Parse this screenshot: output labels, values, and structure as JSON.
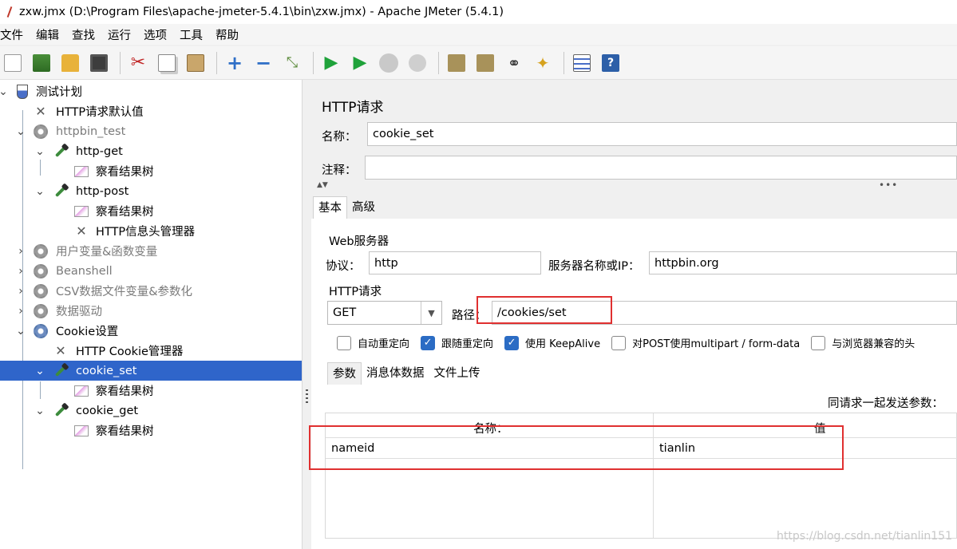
{
  "window": {
    "title": "zxw.jmx (D:\\Program Files\\apache-jmeter-5.4.1\\bin\\zxw.jmx) - Apache JMeter (5.4.1)"
  },
  "menu": [
    "文件",
    "编辑",
    "查找",
    "运行",
    "选项",
    "工具",
    "帮助"
  ],
  "toolbar": {
    "icons": [
      "new-icon",
      "templates-icon",
      "open-icon",
      "save-icon",
      "cut-icon",
      "copy-icon",
      "paste-icon",
      "expand-icon",
      "collapse-icon",
      "toggle-icon",
      "start-icon",
      "start-no-pauses-icon",
      "stop-icon",
      "shutdown-icon",
      "clear-icon",
      "clear-all-icon",
      "search-icon",
      "reset-search-icon",
      "function-helper-icon",
      "help-icon"
    ]
  },
  "tree": {
    "items": [
      {
        "label": "测试计划",
        "icon": "flask-icon",
        "level": 0
      },
      {
        "label": "HTTP请求默认值",
        "icon": "wrench-icon",
        "level": 1
      },
      {
        "label": "httpbin_test",
        "icon": "gear-icon",
        "level": 1,
        "disabled": true
      },
      {
        "label": "http-get",
        "icon": "sampler-icon",
        "level": 2
      },
      {
        "label": "察看结果树",
        "icon": "listener-icon",
        "level": 3
      },
      {
        "label": "http-post",
        "icon": "sampler-icon",
        "level": 2
      },
      {
        "label": "察看结果树",
        "icon": "listener-icon",
        "level": 3
      },
      {
        "label": "HTTP信息头管理器",
        "icon": "wrench-icon",
        "level": 3
      },
      {
        "label": "用户变量&函数变量",
        "icon": "gear-icon",
        "level": 1,
        "disabled": true
      },
      {
        "label": "Beanshell",
        "icon": "gear-icon",
        "level": 1,
        "disabled": true
      },
      {
        "label": "CSV数据文件变量&参数化",
        "icon": "gear-icon",
        "level": 1,
        "disabled": true
      },
      {
        "label": "数据驱动",
        "icon": "gear-icon",
        "level": 1,
        "disabled": true
      },
      {
        "label": "Cookie设置",
        "icon": "gear-icon",
        "level": 1
      },
      {
        "label": "HTTP Cookie管理器",
        "icon": "wrench-icon",
        "level": 2
      },
      {
        "label": "cookie_set",
        "icon": "sampler-icon",
        "level": 2,
        "selected": true
      },
      {
        "label": "察看结果树",
        "icon": "listener-icon",
        "level": 3
      },
      {
        "label": "cookie_get",
        "icon": "sampler-icon",
        "level": 2
      },
      {
        "label": "察看结果树",
        "icon": "listener-icon",
        "level": 3
      }
    ]
  },
  "panel": {
    "title": "HTTP请求",
    "name_label": "名称：",
    "name_value": "cookie_set",
    "comment_label": "注释：",
    "comment_value": "",
    "tabs": [
      "基本",
      "高级"
    ],
    "web_server": {
      "legend": "Web服务器",
      "protocol_label": "协议：",
      "protocol_value": "http",
      "server_label": "服务器名称或IP：",
      "server_value": "httpbin.org"
    },
    "http_request": {
      "legend": "HTTP请求",
      "method": "GET",
      "path_label": "路径：",
      "path_value": "/cookies/set",
      "checkboxes": [
        {
          "label": "自动重定向",
          "checked": false
        },
        {
          "label": "跟随重定向",
          "checked": true
        },
        {
          "label": "使用 KeepAlive",
          "checked": true
        },
        {
          "label": "对POST使用multipart / form-data",
          "checked": false
        },
        {
          "label": "与浏览器兼容的头",
          "checked": false
        }
      ]
    },
    "param_tabs": [
      "参数",
      "消息体数据",
      "文件上传"
    ],
    "params_caption": "同请求一起发送参数：",
    "params_columns": [
      "名称：",
      "值"
    ],
    "params_rows": [
      {
        "name": "nameid",
        "value": "tianlin"
      }
    ]
  },
  "watermark": "https://blog.csdn.net/tianlin151"
}
